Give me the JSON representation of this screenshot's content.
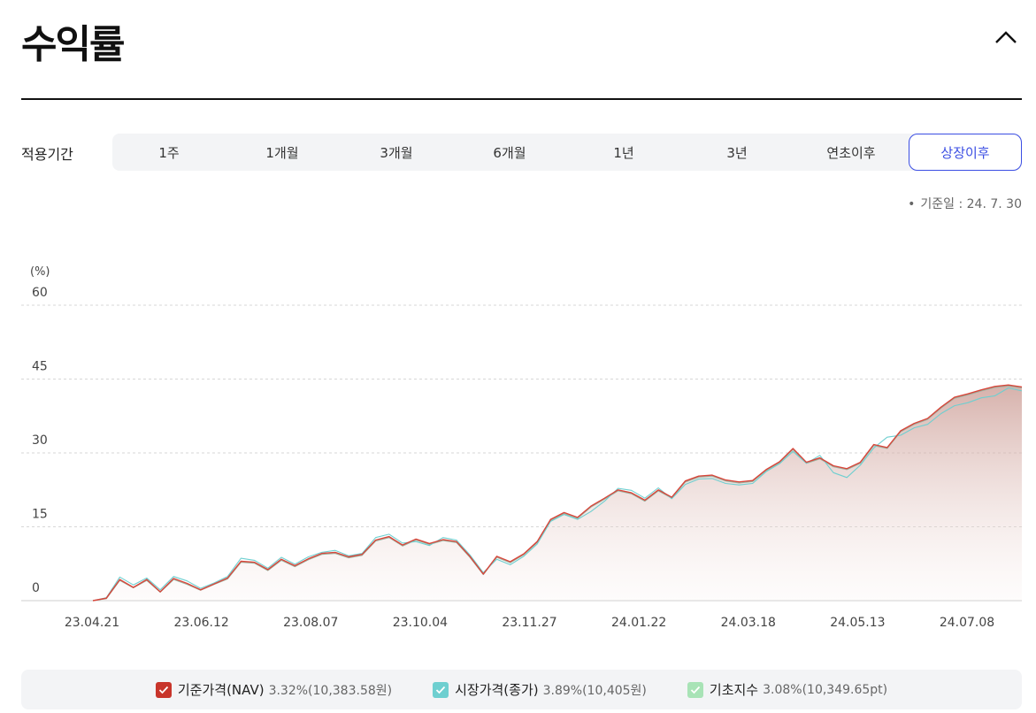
{
  "page": {
    "title": "수익률"
  },
  "period": {
    "label": "적용기간",
    "tabs": [
      "1주",
      "1개월",
      "3개월",
      "6개월",
      "1년",
      "3년",
      "연초이후",
      "상장이후"
    ],
    "active_index": 7
  },
  "basis_date": "기준일 : 24. 7. 30",
  "colors": {
    "nav": "#d9453a",
    "market": "#6ecfd0",
    "index": "#a8e3b6",
    "active_tab": "#3b4ee3"
  },
  "chart_data": {
    "type": "line",
    "unit_label": "(%)",
    "ylim": [
      0,
      60
    ],
    "yticks": [
      "0",
      "15",
      "30",
      "45",
      "60"
    ],
    "grid": true,
    "xlabels": [
      "23.04.21",
      "23.06.12",
      "23.08.07",
      "23.10.04",
      "23.11.27",
      "24.01.22",
      "24.03.18",
      "24.05.13",
      "24.07.08"
    ],
    "legend_position": "bottom",
    "x": [
      "23.04.07",
      "23.04.14",
      "23.04.21",
      "23.04.28",
      "23.05.05",
      "23.05.12",
      "23.05.19",
      "23.05.26",
      "23.06.02",
      "23.06.09",
      "23.06.16",
      "23.06.23",
      "23.06.30",
      "23.07.07",
      "23.07.14",
      "23.07.21",
      "23.07.28",
      "23.08.04",
      "23.08.11",
      "23.08.18",
      "23.08.25",
      "23.09.01",
      "23.09.08",
      "23.09.15",
      "23.09.22",
      "23.09.29",
      "23.10.06",
      "23.10.13",
      "23.10.20",
      "23.10.27",
      "23.11.03",
      "23.11.10",
      "23.11.17",
      "23.11.24",
      "23.12.01",
      "23.12.08",
      "23.12.15",
      "23.12.22",
      "23.12.29",
      "24.01.05",
      "24.01.12",
      "24.01.19",
      "24.01.26",
      "24.02.02",
      "24.02.09",
      "24.02.16",
      "24.02.23",
      "24.03.01",
      "24.03.08",
      "24.03.15",
      "24.03.22",
      "24.03.29",
      "24.04.05",
      "24.04.12",
      "24.04.19",
      "24.04.26",
      "24.05.03",
      "24.05.10",
      "24.05.17",
      "24.05.24",
      "24.05.31",
      "24.06.07",
      "24.06.14",
      "24.06.21",
      "24.06.28",
      "24.07.05",
      "24.07.12",
      "24.07.19",
      "24.07.26",
      "24.07.30"
    ],
    "series": [
      {
        "name": "기준가격(NAV)",
        "values": [
          0,
          0.5,
          4.3,
          2.7,
          4.3,
          1.8,
          4.5,
          3.5,
          2.2,
          3.4,
          4.6,
          8.0,
          7.8,
          6.3,
          8.4,
          7.1,
          8.5,
          9.6,
          9.8,
          8.9,
          9.4,
          12.3,
          13.0,
          11.3,
          12.5,
          11.6,
          12.4,
          12.0,
          9.0,
          5.4,
          9.0,
          7.9,
          9.5,
          12.0,
          16.5,
          17.9,
          16.9,
          19.2,
          20.8,
          22.5,
          21.9,
          20.4,
          22.5,
          21.0,
          24.3,
          25.3,
          25.5,
          24.5,
          24.1,
          24.4,
          26.6,
          28.2,
          30.9,
          28.1,
          29.0,
          27.4,
          26.8,
          28.1,
          31.7,
          31.1,
          34.5,
          36.0,
          37.0,
          39.3,
          41.3,
          42.0,
          42.8,
          43.5,
          43.8,
          43.4
        ],
        "summary": "3.32%(10,383.58원)"
      },
      {
        "name": "시장가격(종가)",
        "values": [
          0,
          0.6,
          4.8,
          3.2,
          4.6,
          2.2,
          4.9,
          4.0,
          2.5,
          3.6,
          4.9,
          8.6,
          8.2,
          6.6,
          8.8,
          7.4,
          8.9,
          9.8,
          10.2,
          9.1,
          9.6,
          12.8,
          13.5,
          11.7,
          12.0,
          11.2,
          12.8,
          12.3,
          9.3,
          5.7,
          8.4,
          7.3,
          9.0,
          11.5,
          16.1,
          17.5,
          16.5,
          18.1,
          20.2,
          22.8,
          22.4,
          20.8,
          22.9,
          20.7,
          23.6,
          24.7,
          24.8,
          23.8,
          23.5,
          23.8,
          26.2,
          27.8,
          30.3,
          27.9,
          29.5,
          26.0,
          25.0,
          27.5,
          31.0,
          33.2,
          33.6,
          35.1,
          35.8,
          38.0,
          39.6,
          40.2,
          41.2,
          41.6,
          43.2,
          42.6
        ],
        "summary": "3.89%(10,405원)"
      },
      {
        "name": "기초지수",
        "values": [
          0,
          0.4,
          4.1,
          2.6,
          4.1,
          1.7,
          4.3,
          3.3,
          2.1,
          3.3,
          4.4,
          7.8,
          7.6,
          6.1,
          8.2,
          6.9,
          8.3,
          9.4,
          9.6,
          8.7,
          9.2,
          12.1,
          12.8,
          11.1,
          12.3,
          11.4,
          12.2,
          11.8,
          8.8,
          5.3,
          8.8,
          7.7,
          9.3,
          11.8,
          16.3,
          17.7,
          16.7,
          19.0,
          20.6,
          22.3,
          21.7,
          20.2,
          22.3,
          20.8,
          24.1,
          25.1,
          25.3,
          24.3,
          23.9,
          24.2,
          26.4,
          28.0,
          30.7,
          27.9,
          28.8,
          27.2,
          26.6,
          27.9,
          31.5,
          30.9,
          34.3,
          35.8,
          36.8,
          39.1,
          41.1,
          41.8,
          42.6,
          43.3,
          43.6,
          43.2
        ],
        "summary": "3.08%(10,349.65pt)"
      }
    ]
  }
}
